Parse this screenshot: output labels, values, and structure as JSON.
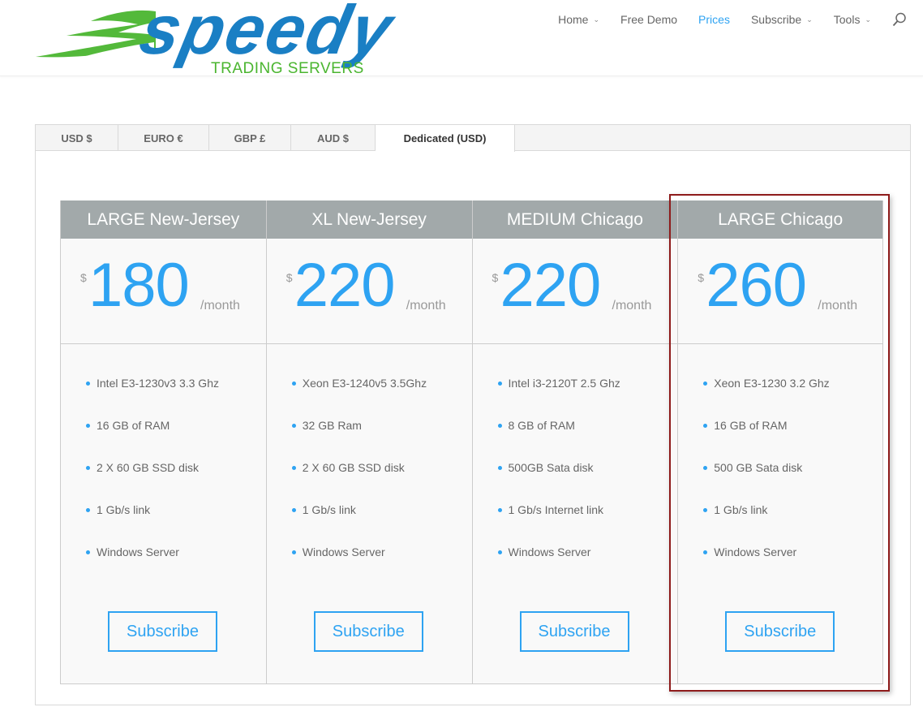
{
  "brand": {
    "name": "speedy",
    "tagline": "TRADING SERVERS",
    "colors": {
      "blue": "#1a7fc4",
      "green": "#4ab52f"
    }
  },
  "nav": {
    "items": [
      {
        "label": "Home",
        "has_dropdown": true,
        "active": false
      },
      {
        "label": "Free Demo",
        "has_dropdown": false,
        "active": false
      },
      {
        "label": "Prices",
        "has_dropdown": false,
        "active": true
      },
      {
        "label": "Subscribe",
        "has_dropdown": true,
        "active": false
      },
      {
        "label": "Tools",
        "has_dropdown": true,
        "active": false
      }
    ],
    "chevron": "⌄",
    "search_icon": "search-icon"
  },
  "tabs": [
    {
      "label": "USD $",
      "active": false
    },
    {
      "label": "EURO €",
      "active": false
    },
    {
      "label": "GBP £",
      "active": false
    },
    {
      "label": "AUD $",
      "active": false
    },
    {
      "label": "Dedicated (USD)",
      "active": true
    }
  ],
  "plans": [
    {
      "title": "LARGE New-Jersey",
      "currency": "$",
      "price": "180",
      "period": "/month",
      "features": [
        "Intel E3-1230v3 3.3 Ghz",
        "16 GB of RAM",
        "2 X 60 GB SSD disk",
        "1 Gb/s link",
        "Windows Server"
      ],
      "button": "Subscribe"
    },
    {
      "title": "XL New-Jersey",
      "currency": "$",
      "price": "220",
      "period": "/month",
      "features": [
        "Xeon E3-1240v5 3.5Ghz",
        "32 GB Ram",
        "2 X 60 GB SSD disk",
        "1 Gb/s link",
        "Windows Server"
      ],
      "button": "Subscribe"
    },
    {
      "title": "MEDIUM Chicago",
      "currency": "$",
      "price": "220",
      "period": "/month",
      "features": [
        "Intel i3-2120T 2.5 Ghz",
        "8 GB of RAM",
        "500GB Sata disk",
        "1 Gb/s Internet link",
        "Windows Server"
      ],
      "button": "Subscribe"
    },
    {
      "title": "LARGE Chicago",
      "currency": "$",
      "price": "260",
      "period": "/month",
      "features": [
        "Xeon E3-1230 3.2 Ghz",
        "16 GB of RAM",
        "500 GB Sata disk",
        "1 Gb/s link",
        "Windows Server"
      ],
      "button": "Subscribe"
    }
  ],
  "theme": {
    "accent": "#2ea3f2",
    "header_gray": "#a2a9aa",
    "highlight_border": "#8e1b1b"
  }
}
